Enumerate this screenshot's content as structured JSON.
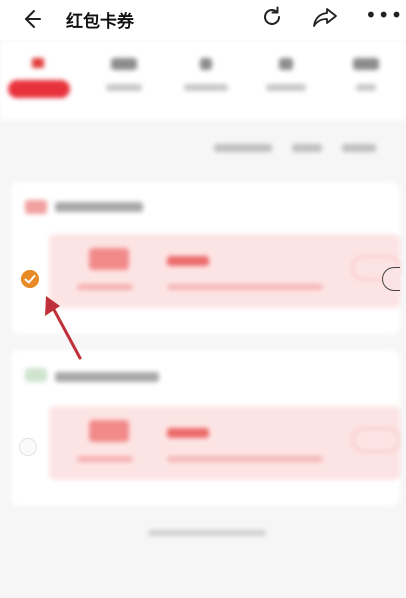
{
  "header": {
    "title": "红包卡券",
    "more_glyph": "•••",
    "icons": [
      "back-arrow-icon",
      "refresh-icon",
      "share-icon",
      "more-icon"
    ]
  },
  "selection": {
    "first_coupon_selected": true,
    "second_coupon_selected": false,
    "check_color": "#e88a25"
  },
  "colors": {
    "accent_red": "#e8323b",
    "coupon_bg": "#fde4e4",
    "annotation_arrow": "#c0303a"
  }
}
